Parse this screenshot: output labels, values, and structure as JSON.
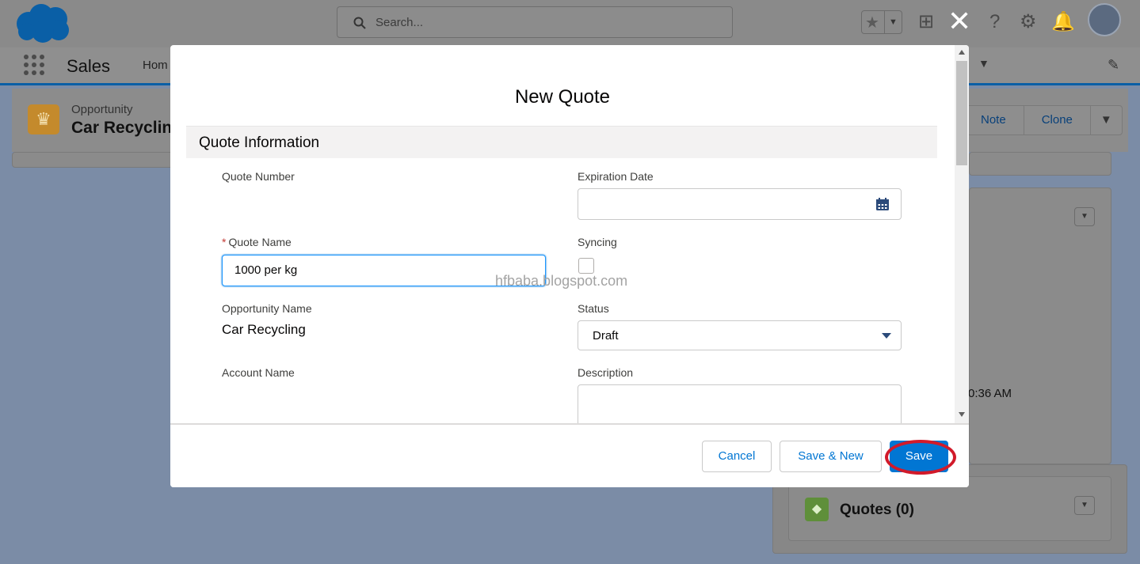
{
  "app": {
    "name": "Sales",
    "search_placeholder": "Search...",
    "nav_home": "Hom",
    "close_symbol": "✕"
  },
  "record": {
    "type": "Opportunity",
    "name": "Car Recyclin",
    "actions": [
      "Note",
      "Clone"
    ]
  },
  "background": {
    "timestamp_fragment": "0:36 AM",
    "quotes_card_title": "Quotes (0)"
  },
  "modal": {
    "title": "New Quote",
    "section_title": "Quote Information",
    "fields": {
      "quote_number_label": "Quote Number",
      "expiration_date_label": "Expiration Date",
      "quote_name_label": "Quote Name",
      "quote_name_required": "*",
      "quote_name_value": "1000 per kg",
      "syncing_label": "Syncing",
      "syncing_checked": false,
      "opportunity_name_label": "Opportunity Name",
      "opportunity_name_value": "Car Recycling",
      "status_label": "Status",
      "status_value": "Draft",
      "account_name_label": "Account Name",
      "description_label": "Description"
    },
    "watermark": "hfbaba.blogspot.com",
    "footer": {
      "cancel_label": "Cancel",
      "save_new_label": "Save & New",
      "save_label": "Save"
    }
  },
  "colors": {
    "brand_blue": "#0176d3",
    "highlight_ring": "#d11a2a",
    "opportunity_icon": "#c48a2c",
    "quotes_icon": "#5f8f3a"
  }
}
